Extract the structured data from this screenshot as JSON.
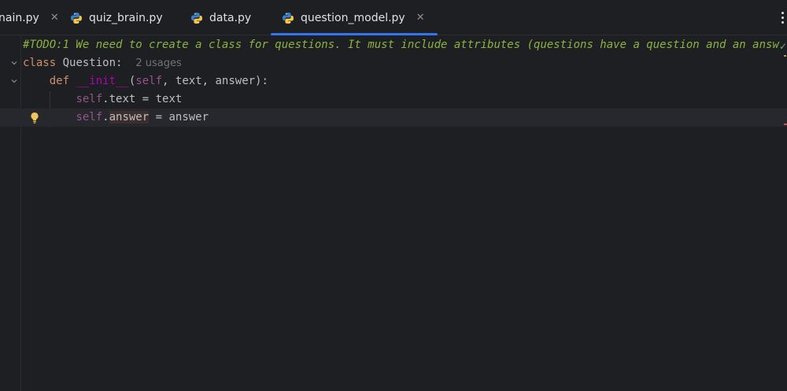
{
  "tabs": [
    {
      "label": "main.py",
      "visible_label": "nain.py",
      "closable": true,
      "active": false
    },
    {
      "label": "quiz_brain.py",
      "closable": false,
      "active": false
    },
    {
      "label": "data.py",
      "closable": false,
      "active": false
    },
    {
      "label": "question_model.py",
      "closable": true,
      "active": true
    }
  ],
  "close_glyph": "✕",
  "editor": {
    "line1": "#TODO:1 We need to create a class for questions. It must include attributes (questions have a question and an answ",
    "line2": {
      "kw": "class",
      "name": " Question:",
      "hint": "2 usages"
    },
    "line3": {
      "kw": "def",
      "fn": "__init__",
      "args_open": "(",
      "self": "self",
      "rest": ", text, answer):"
    },
    "line4": {
      "self": "self",
      "rest": ".text = text"
    },
    "line5": {
      "self": "self",
      "dot": ".",
      "attr": "answer",
      "rest": " = answer"
    }
  },
  "colors": {
    "background": "#1e1f22",
    "accent": "#3574f0",
    "keyword": "#cf8e6d",
    "self": "#94558d",
    "todo": "#8bb33d"
  },
  "icons": [
    "python-file-icon",
    "close-icon",
    "more-options-icon",
    "fold-arrow-icon",
    "lightbulb-icon",
    "inspection-ok-icon"
  ]
}
